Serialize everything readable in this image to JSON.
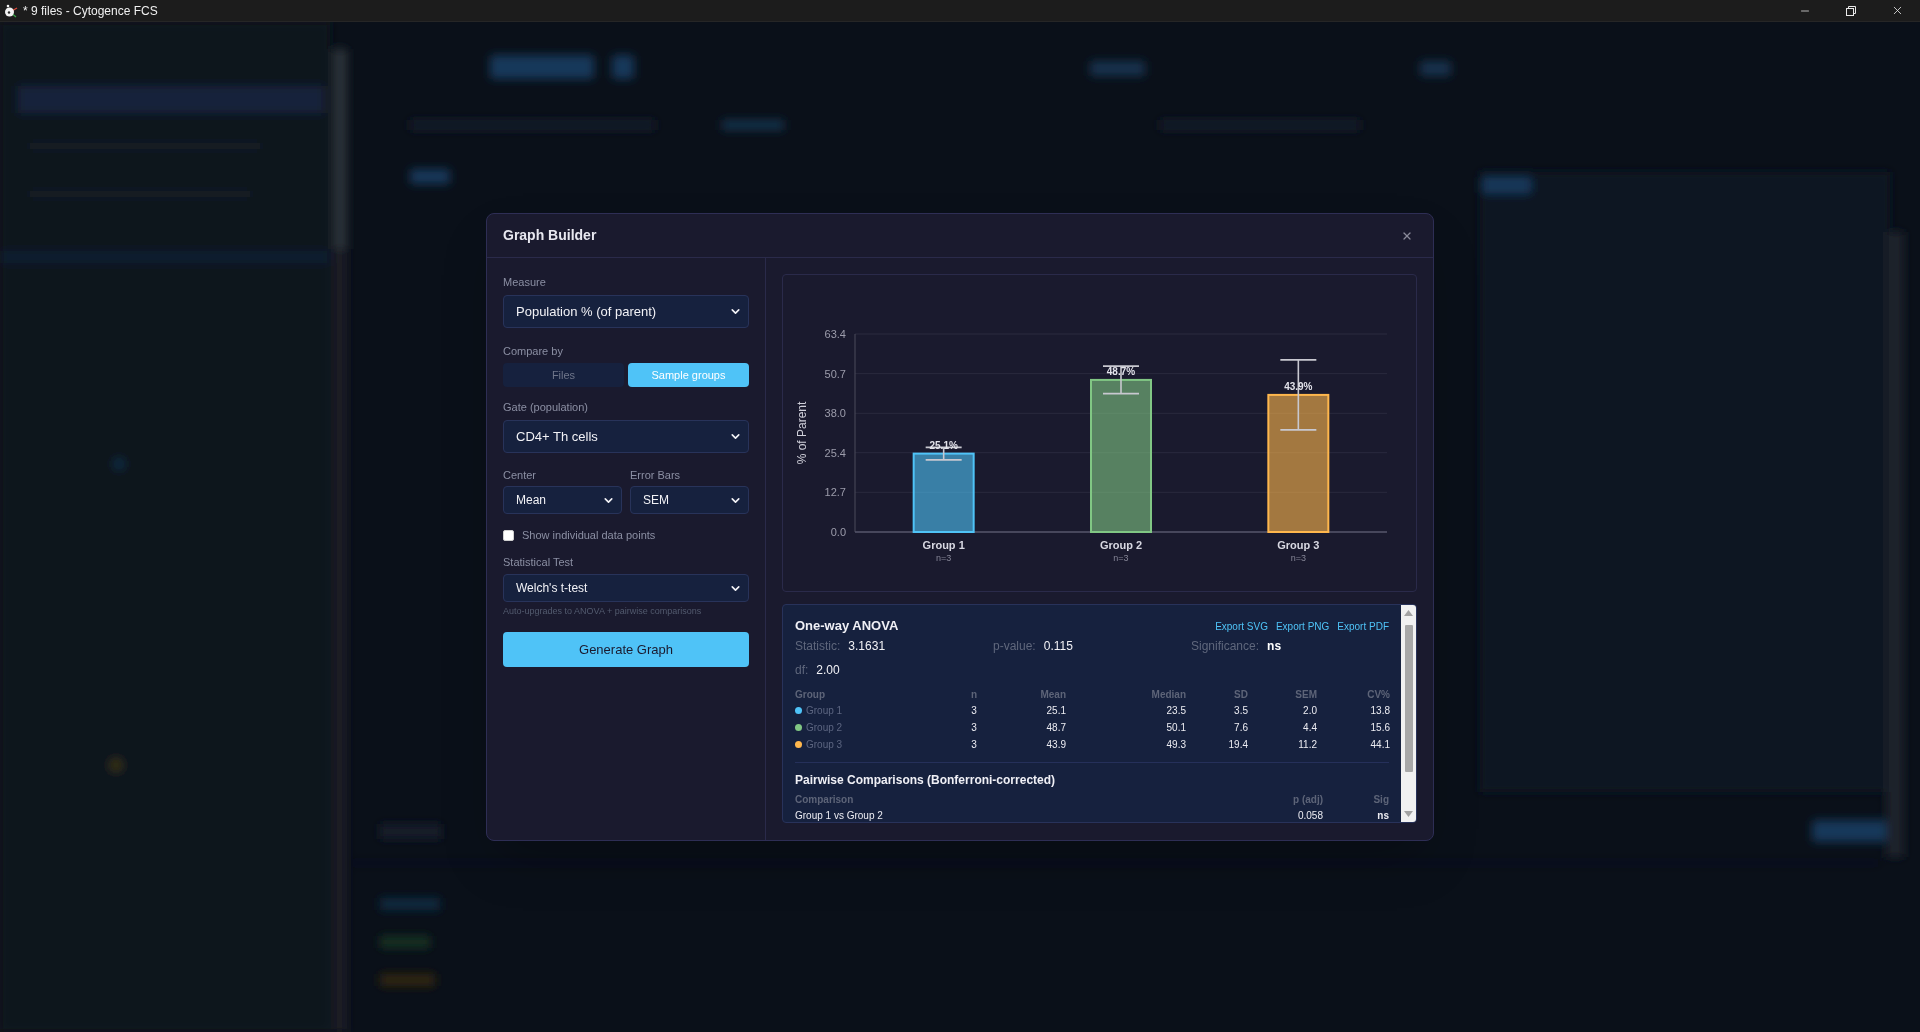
{
  "window": {
    "title": "* 9 files - Cytogence FCS"
  },
  "dialog": {
    "title": "Graph Builder",
    "controls": {
      "measure": {
        "label": "Measure",
        "value": "Population % (of parent)"
      },
      "compare_by": {
        "label": "Compare by",
        "options": [
          {
            "label": "Files",
            "selected": false
          },
          {
            "label": "Sample groups",
            "selected": true
          }
        ]
      },
      "gate": {
        "label": "Gate (population)",
        "value": "CD4+ Th cells"
      },
      "center": {
        "label": "Center",
        "value": "Mean"
      },
      "error_bars": {
        "label": "Error Bars",
        "value": "SEM"
      },
      "show_points": {
        "label": "Show individual data points",
        "checked": false
      },
      "statistical_test": {
        "label": "Statistical Test",
        "value": "Welch's t-test",
        "hint": "Auto-upgrades to ANOVA + pairwise comparisons"
      },
      "generate_button": "Generate Graph"
    },
    "chart": {
      "chart_data": {
        "type": "bar",
        "ylabel": "% of Parent",
        "categories": [
          "Group 1",
          "Group 2",
          "Group 3"
        ],
        "series": [
          {
            "values": [
              25.1,
              48.7,
              43.9
            ],
            "errors": [
              2.0,
              4.4,
              11.2
            ]
          }
        ],
        "colors": [
          "#4fc3f7",
          "#81c784",
          "#ffb74d"
        ],
        "ylim": [
          0,
          63.4
        ],
        "yticks": [
          {
            "value": 0,
            "label": "0.0"
          },
          {
            "value": 12.7,
            "label": "12.7"
          },
          {
            "value": 25.4,
            "label": "25.4"
          },
          {
            "value": 38.0,
            "label": "38.0"
          },
          {
            "value": 50.7,
            "label": "50.7"
          },
          {
            "value": 63.4,
            "label": "63.4"
          }
        ],
        "grid": true,
        "value_labels": [
          "25.1%",
          "48.7%",
          "43.9%"
        ],
        "annotations": [
          "n=3",
          "n=3",
          "n=3"
        ]
      }
    },
    "results": {
      "title": "One-way ANOVA",
      "exports": [
        "Export SVG",
        "Export PNG",
        "Export PDF"
      ],
      "stats": [
        {
          "label": "Statistic:",
          "value": "3.1631",
          "bold": false
        },
        {
          "label": "p-value:",
          "value": "0.115",
          "bold": false
        },
        {
          "label": "Significance:",
          "value": "ns",
          "bold": true
        },
        {
          "label": "df:",
          "value": "2.00",
          "bold": false
        }
      ],
      "groups": {
        "columns": [
          "Group",
          "n",
          "Mean",
          "Median",
          "SD",
          "SEM",
          "CV%"
        ],
        "rows": [
          {
            "color": "#4fc3f7",
            "cells": [
              "Group 1",
              "3",
              "25.1",
              "23.5",
              "3.5",
              "2.0",
              "13.8"
            ]
          },
          {
            "color": "#81c784",
            "cells": [
              "Group 2",
              "3",
              "48.7",
              "50.1",
              "7.6",
              "4.4",
              "15.6"
            ]
          },
          {
            "color": "#ffb74d",
            "cells": [
              "Group 3",
              "3",
              "43.9",
              "49.3",
              "19.4",
              "11.2",
              "44.1"
            ]
          }
        ]
      },
      "pairwise": {
        "title": "Pairwise Comparisons (Bonferroni-corrected)",
        "columns": [
          "Comparison",
          "p (adj)",
          "Sig"
        ],
        "rows": [
          {
            "cells": [
              "Group 1 vs Group 2",
              "0.058",
              "ns"
            ]
          }
        ]
      }
    }
  }
}
